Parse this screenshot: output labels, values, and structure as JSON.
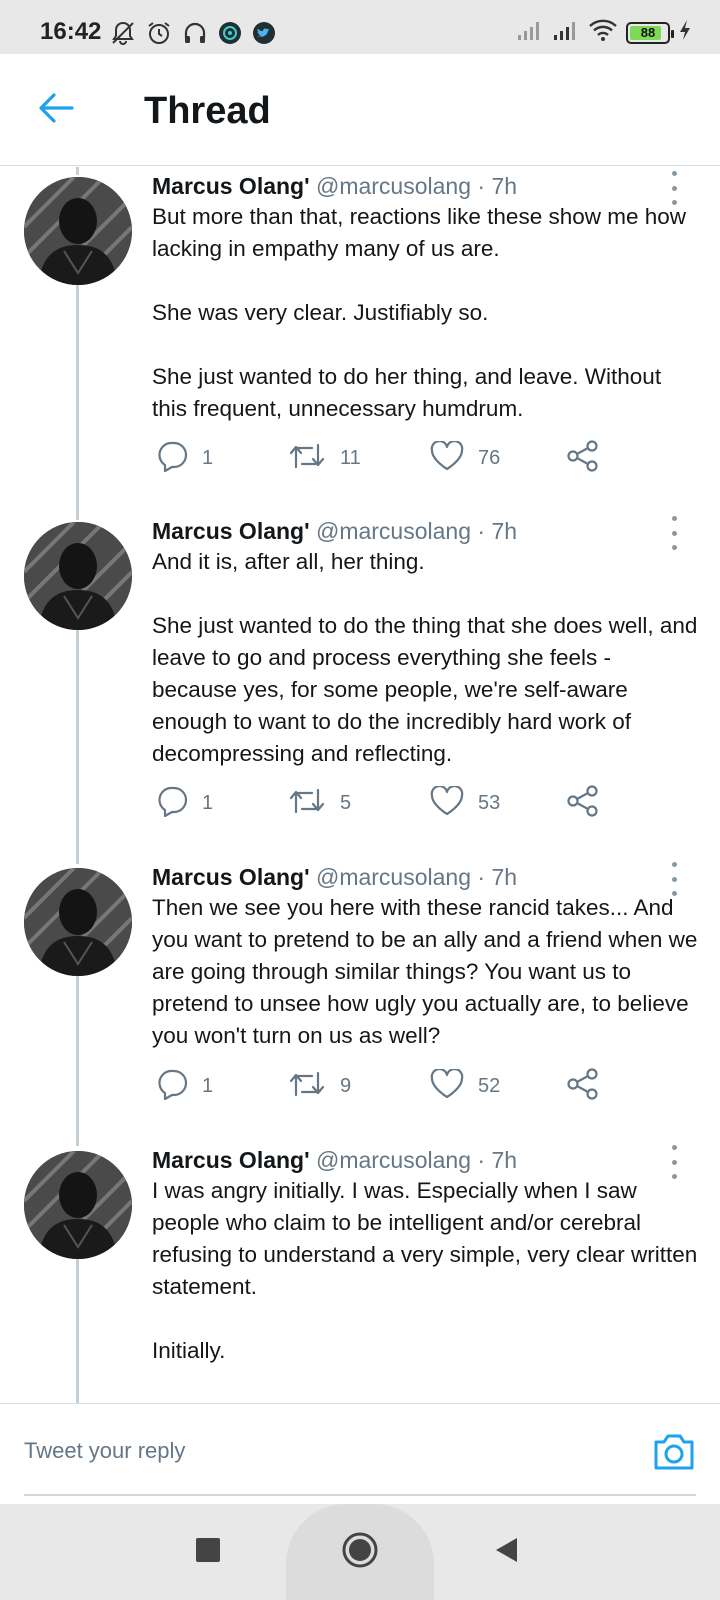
{
  "status_bar": {
    "time": "16:42",
    "battery_level": "88",
    "battery_fraction": 0.88,
    "left_icons": [
      "notifications-off-icon",
      "alarm-icon",
      "headphones-icon",
      "app-icon",
      "twitter-icon"
    ],
    "right_icons": [
      "signal-icon",
      "signal-icon",
      "wifi-icon",
      "battery-icon",
      "charging-icon"
    ]
  },
  "header": {
    "title": "Thread",
    "back_icon": "arrow-left-icon",
    "accent_color": "#1da1f2"
  },
  "tweets": [
    {
      "name": "Marcus Olang'",
      "handle": "@marcusolang",
      "time": "· 7h",
      "text": "But more than that, reactions like these show me how lacking in empathy many of us are.\n\nShe was very clear. Justifiably so.\n\nShe just wanted to do her thing, and leave. Without this frequent, unnecessary humdrum.",
      "replies": "1",
      "retweets": "11",
      "likes": "76"
    },
    {
      "name": "Marcus Olang'",
      "handle": "@marcusolang",
      "time": "· 7h",
      "text": "And it is, after all, her thing.\n\nShe just wanted to do the thing that she does well, and leave to go and process everything she feels - because yes, for some people, we're self-aware enough to want to do the incredibly hard work of decompressing and reflecting.",
      "replies": "1",
      "retweets": "5",
      "likes": "53"
    },
    {
      "name": "Marcus Olang'",
      "handle": "@marcusolang",
      "time": "· 7h",
      "text": "Then we see you here with these rancid takes... And you want to pretend to be an ally and a friend when we are going through similar things? You want us to pretend to unsee how ugly you actually are, to believe you won't turn on us as well?",
      "replies": "1",
      "retweets": "9",
      "likes": "52"
    },
    {
      "name": "Marcus Olang'",
      "handle": "@marcusolang",
      "time": "· 7h",
      "text": "I was angry initially. I was. Especially when I saw people who claim to be intelligent and/or cerebral refusing to understand a very simple, very clear written statement.\n\nInitially."
    }
  ],
  "reply_bar": {
    "placeholder": "Tweet your reply",
    "camera_icon": "camera-icon"
  },
  "nav_bar": {
    "icons": [
      "recents-square-icon",
      "home-circle-icon",
      "back-triangle-icon"
    ]
  }
}
